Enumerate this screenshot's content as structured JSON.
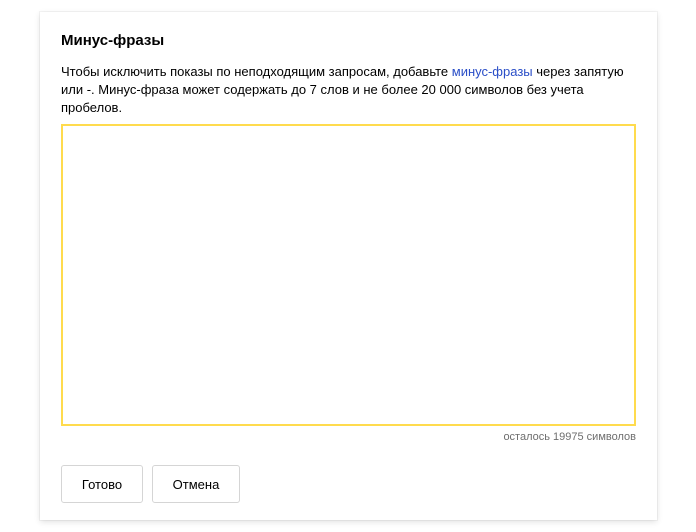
{
  "dialog": {
    "title": "Минус-фразы",
    "description": {
      "text_before_link": "Чтобы исключить показы по неподходящим запросам, добавьте ",
      "link_text": "минус-фразы",
      "text_after_link": " через запятую или -. Минус-фраза может содержать до 7 слов и не более 20 000 символов без учета пробелов."
    },
    "input": {
      "value": "",
      "placeholder": ""
    },
    "counter": "осталось 19975 символов",
    "buttons": {
      "done_label": "Готово",
      "cancel_label": "Отмена"
    }
  },
  "colors": {
    "link": "#2a4ec7",
    "input_border": "#ffdb4d",
    "counter_text": "#6e6e6e",
    "button_border": "#d5d5d5"
  }
}
